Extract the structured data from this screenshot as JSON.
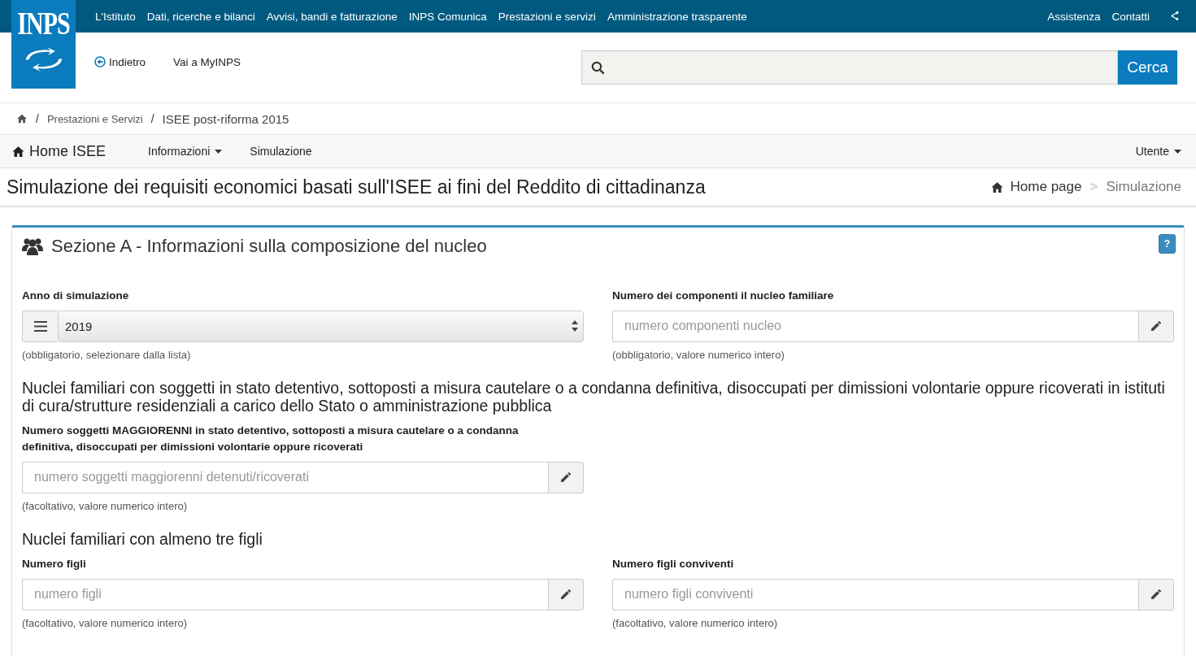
{
  "topbar": {
    "links": [
      "L'Istituto",
      "Dati, ricerche e bilanci",
      "Avvisi, bandi e fatturazione",
      "INPS Comunica",
      "Prestazioni e servizi",
      "Amministrazione trasparente"
    ],
    "right_links": [
      "Assistenza",
      "Contatti"
    ]
  },
  "header": {
    "logo_text": "INPS",
    "back_link": "Indietro",
    "myinps_link": "Vai a MyINPS",
    "search_button": "Cerca"
  },
  "breadcrumb": [
    "Prestazioni e Servizi",
    "ISEE post-riforma 2015"
  ],
  "breadcrumb_separator": "/",
  "page_breadcrumb_separator": ">",
  "navbar": {
    "brand": "Home ISEE",
    "items": [
      {
        "label": "Informazioni",
        "dropdown": true
      },
      {
        "label": "Simulazione",
        "dropdown": false
      }
    ],
    "user": "Utente"
  },
  "page_title": "Simulazione dei requisiti economici basati sull'ISEE ai fini del Reddito di cittadinanza",
  "page_breadcrumb": [
    "Home page",
    "Simulazione"
  ],
  "section": {
    "title": "Sezione A - Informazioni sulla composizione del nucleo",
    "help": "?",
    "blocks": [
      {
        "kind": "fields",
        "fields": [
          {
            "kind": "select",
            "label": "Anno di simulazione",
            "value": "2019",
            "hint": "(obbligatorio, selezionare dalla lista)"
          },
          {
            "kind": "input",
            "label": "Numero dei componenti il nucleo familiare",
            "placeholder": "numero componenti nucleo",
            "hint": "(obbligatorio, valore numerico intero)"
          }
        ]
      },
      {
        "kind": "heading",
        "text": "Nuclei familiari con soggetti in stato detentivo, sottoposti a misura cautelare o a condanna definitiva, disoccupati per dimissioni volontarie oppure ricoverati in istituti di cura/strutture residenziali a carico dello Stato o amministrazione pubblica"
      },
      {
        "kind": "fields",
        "fields": [
          {
            "kind": "input",
            "label": "Numero soggetti MAGGIORENNI in stato detentivo, sottoposti a misura cautelare o a condanna definitiva, disoccupati per dimissioni volontarie oppure ricoverati",
            "placeholder": "numero soggetti maggiorenni detenuti/ricoverati",
            "hint": "(facoltativo, valore numerico intero)"
          }
        ]
      },
      {
        "kind": "heading",
        "text": "Nuclei familiari con almeno tre figli"
      },
      {
        "kind": "fields",
        "fields": [
          {
            "kind": "input",
            "label": "Numero figli",
            "placeholder": "numero figli",
            "hint": "(facoltativo, valore numerico intero)"
          },
          {
            "kind": "input",
            "label": "Numero figli conviventi",
            "placeholder": "numero figli conviventi",
            "hint": "(facoltativo, valore numerico intero)"
          }
        ]
      }
    ]
  }
}
